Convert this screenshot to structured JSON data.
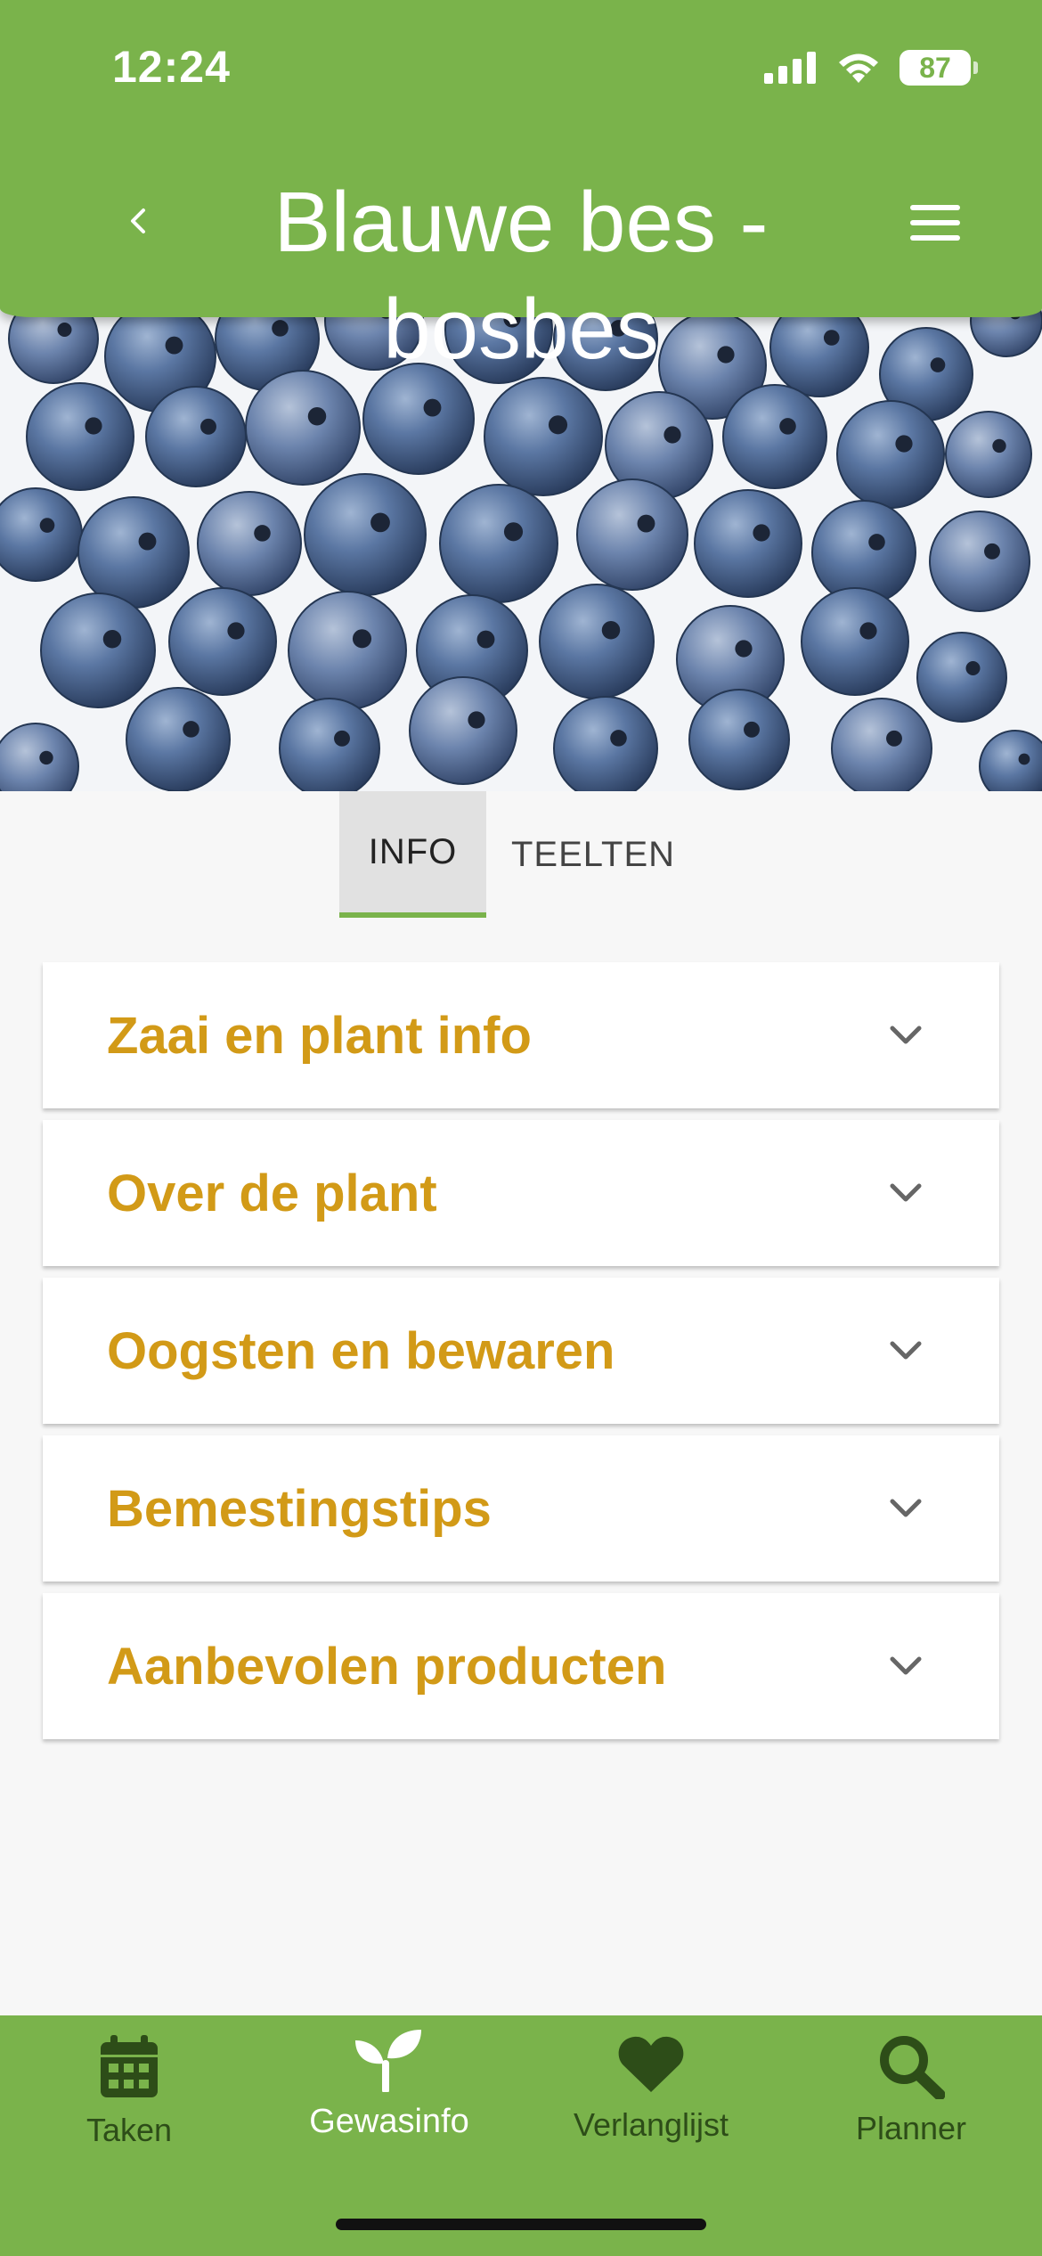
{
  "status_bar": {
    "time": "12:24",
    "battery": "87"
  },
  "header": {
    "title": "Blauwe bes - bosbes"
  },
  "tabs": [
    {
      "label": "INFO"
    },
    {
      "label": "TEELTEN"
    }
  ],
  "sections": [
    {
      "title": "Zaai en plant info"
    },
    {
      "title": "Over de plant"
    },
    {
      "title": "Oogsten en bewaren"
    },
    {
      "title": "Bemestingstips"
    },
    {
      "title": "Aanbevolen producten"
    }
  ],
  "bottom_nav": [
    {
      "label": "Taken",
      "icon": "calendar-icon"
    },
    {
      "label": "Gewasinfo",
      "icon": "sprout-icon"
    },
    {
      "label": "Verlanglijst",
      "icon": "heart-icon"
    },
    {
      "label": "Planner",
      "icon": "search-icon"
    }
  ],
  "colors": {
    "brand_green": "#7ab34b",
    "accent_gold": "#d29a17",
    "nav_icon_dark": "#2d4d18"
  }
}
